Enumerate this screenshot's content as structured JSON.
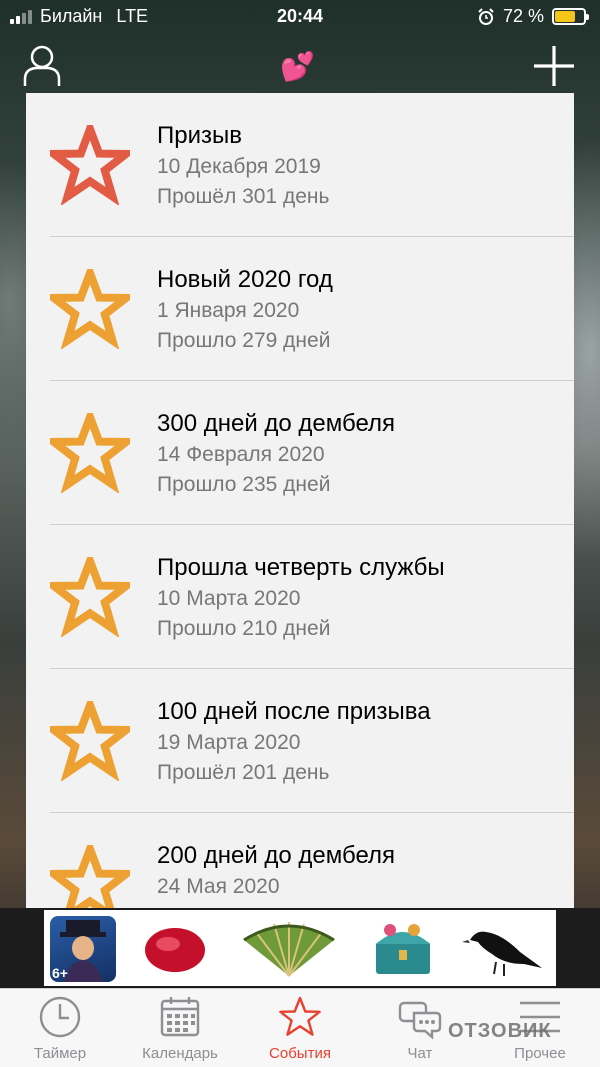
{
  "status_bar": {
    "carrier": "Билайн",
    "network": "LTE",
    "time": "20:44",
    "battery": "72 %",
    "battery_level": 0.72
  },
  "nav": {
    "left_icon": "user-icon",
    "center_icon": "hearts-icon",
    "center_glyph": "💕",
    "right_icon": "plus-icon"
  },
  "events": [
    {
      "title": "Призыв",
      "date": "10 Декабря 2019",
      "elapsed": "Прошёл 301 день",
      "star_color": "#e25b45"
    },
    {
      "title": "Новый 2020 год",
      "date": "1 Января 2020",
      "elapsed": "Прошло 279 дней",
      "star_color": "#eda133"
    },
    {
      "title": "300 дней до дембеля",
      "date": "14 Февраля 2020",
      "elapsed": "Прошло 235 дней",
      "star_color": "#eda133"
    },
    {
      "title": "Прошла четверть службы",
      "date": "10 Марта 2020",
      "elapsed": "Прошло 210 дней",
      "star_color": "#eda133"
    },
    {
      "title": "100 дней после призыва",
      "date": "19 Марта 2020",
      "elapsed": "Прошёл 201 день",
      "star_color": "#eda133"
    },
    {
      "title": "200 дней до дембеля",
      "date": "24 Мая 2020",
      "elapsed": "",
      "star_color": "#eda133"
    }
  ],
  "ad": {
    "age_rating": "6+",
    "items": [
      "game-icon",
      "ruby-icon",
      "fan-icon",
      "chest-icon",
      "raven-icon"
    ]
  },
  "tabs": [
    {
      "label": "Таймер",
      "icon": "clock-icon",
      "active": false
    },
    {
      "label": "Календарь",
      "icon": "calendar-icon",
      "active": false
    },
    {
      "label": "События",
      "icon": "star-icon",
      "active": true
    },
    {
      "label": "Чат",
      "icon": "chat-icon",
      "active": false
    },
    {
      "label": "Прочее",
      "icon": "menu-icon",
      "active": false
    }
  ],
  "watermark": "ОТЗОВИК",
  "colors": {
    "accent": "#e8402e",
    "star_primary": "#e25b45",
    "star_secondary": "#eda133",
    "list_background": "#f2f2f2"
  }
}
